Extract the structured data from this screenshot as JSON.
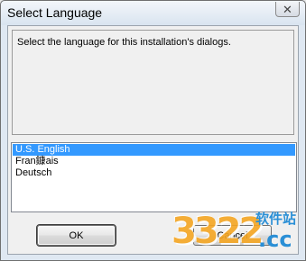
{
  "window": {
    "title": "Select Language",
    "close_glyph": "✕"
  },
  "message": "Select the language for this installation's dialogs.",
  "languages": [
    {
      "label": "U.S. English",
      "selected": true
    },
    {
      "label": "Fran鏮ais",
      "selected": false
    },
    {
      "label": "Deutsch",
      "selected": false
    }
  ],
  "buttons": {
    "ok_label": "OK",
    "cancel_label": "Cancel"
  },
  "watermark": {
    "digits": "3322",
    "cn_text": "软件站",
    "domain": ".cc"
  },
  "colors": {
    "selection": "#3399ff",
    "watermark_orange": "#f5a623",
    "watermark_blue": "#2a8fd6"
  }
}
